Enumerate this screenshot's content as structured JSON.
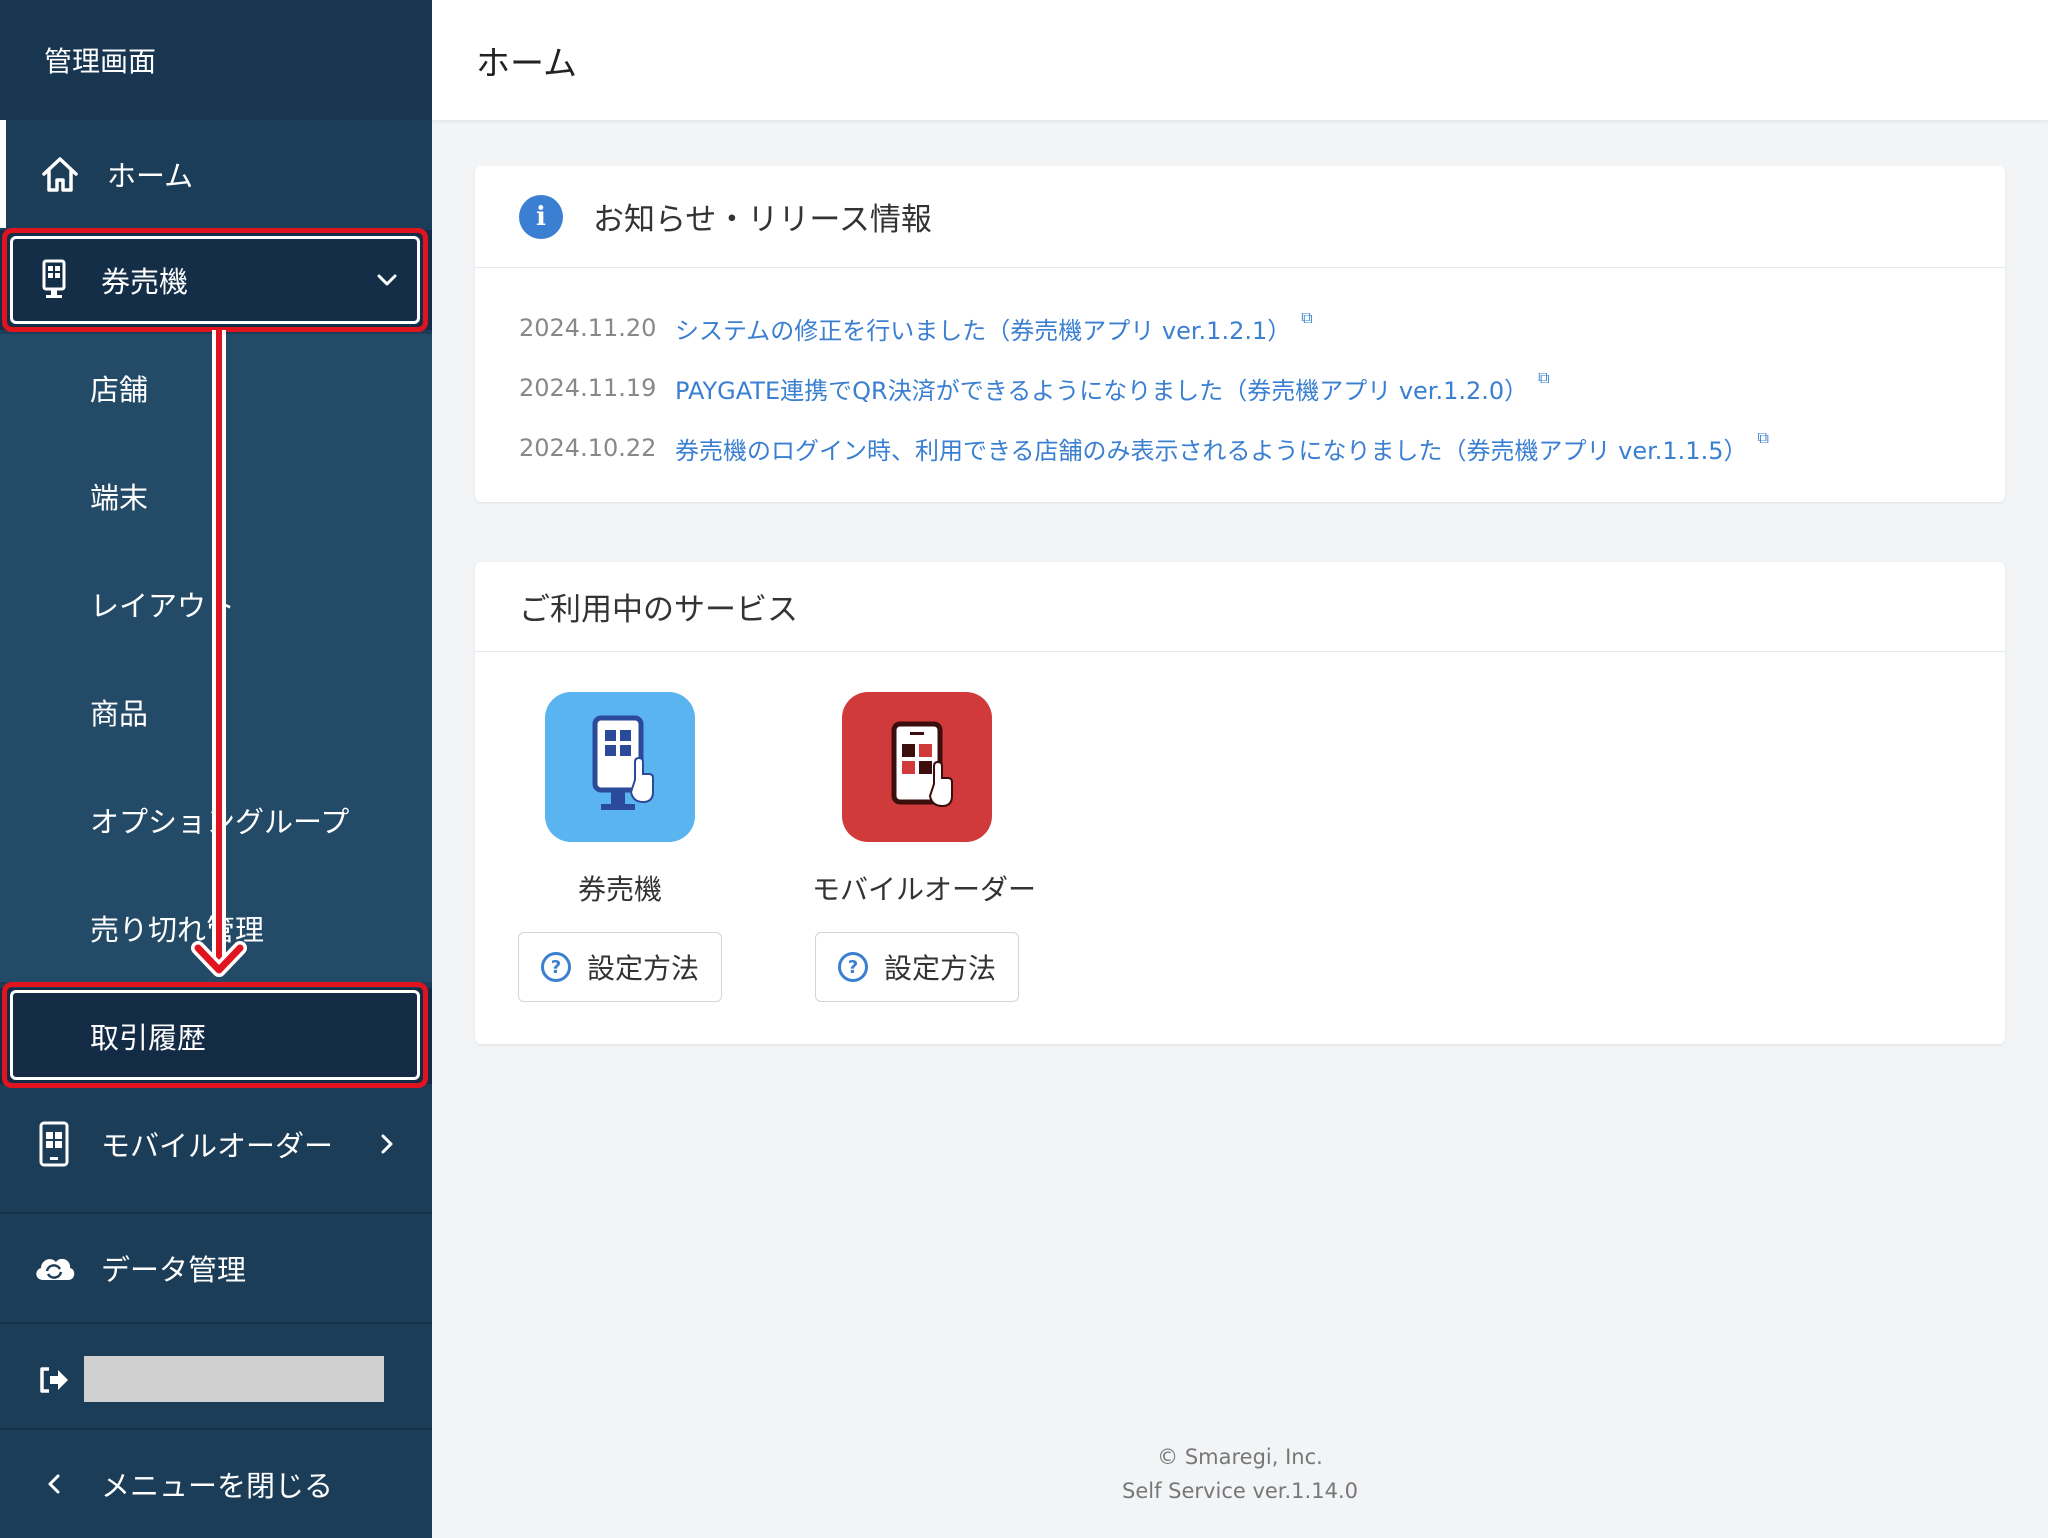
{
  "sidebar": {
    "title": "管理画面",
    "home_label": "ホーム",
    "ticket_label": "券売機",
    "sub_items": [
      "店舗",
      "端末",
      "レイアウト",
      "商品",
      "オプショングループ",
      "売り切れ管理",
      "取引履歴"
    ],
    "mobile_label": "モバイルオーダー",
    "data_label": "データ管理",
    "close_label": "メニューを閉じる",
    "icons": [
      "home-icon",
      "kiosk-icon",
      "chevron-down-icon",
      "mobile-icon",
      "chevron-right-icon",
      "cloud-sync-icon",
      "logout-icon",
      "chevron-left-icon"
    ]
  },
  "header": {
    "title": "ホーム"
  },
  "news": {
    "title": "お知らせ・リリース情報",
    "items": [
      {
        "date": "2024.11.20",
        "text": "システムの修正を行いました（券売機アプリ ver.1.2.1）"
      },
      {
        "date": "2024.11.19",
        "text": "PAYGATE連携でQR決済ができるようになりました（券売機アプリ ver.1.2.0）"
      },
      {
        "date": "2024.10.22",
        "text": "券売機のログイン時、利用できる店舗のみ表示されるようになりました（券売機アプリ ver.1.1.5）"
      }
    ]
  },
  "services": {
    "title": "ご利用中のサービス",
    "items": [
      {
        "name": "券売機",
        "button": "設定方法",
        "color": "#5ab4ef"
      },
      {
        "name": "モバイルオーダー",
        "button": "設定方法",
        "color": "#d13a3a"
      }
    ]
  },
  "footer": {
    "copyright": "© Smaregi, Inc.",
    "version": "Self Service ver.1.14.0"
  },
  "colors": {
    "sidebar": "#1c3d57",
    "accent": "#3a7fd1",
    "highlight": "#e0141e"
  }
}
